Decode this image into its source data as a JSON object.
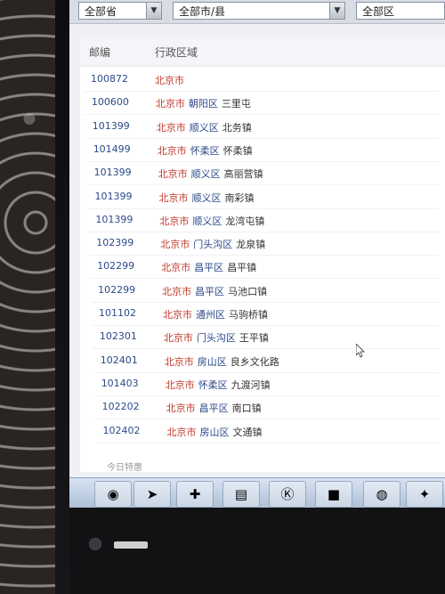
{
  "filters": {
    "province": "全部省",
    "city": "全部市/县",
    "district": "全部区"
  },
  "table": {
    "headers": {
      "postcode": "邮编",
      "region": "行政区域"
    },
    "rows": [
      {
        "postcode": "100872",
        "city": "北京市",
        "district": "",
        "town": ""
      },
      {
        "postcode": "100600",
        "city": "北京市",
        "district": "朝阳区",
        "town": "三里屯"
      },
      {
        "postcode": "101399",
        "city": "北京市",
        "district": "顺义区",
        "town": "北务镇"
      },
      {
        "postcode": "101499",
        "city": "北京市",
        "district": "怀柔区",
        "town": "怀柔镇"
      },
      {
        "postcode": "101399",
        "city": "北京市",
        "district": "顺义区",
        "town": "高丽营镇"
      },
      {
        "postcode": "101399",
        "city": "北京市",
        "district": "顺义区",
        "town": "南彩镇"
      },
      {
        "postcode": "101399",
        "city": "北京市",
        "district": "顺义区",
        "town": "龙湾屯镇"
      },
      {
        "postcode": "102399",
        "city": "北京市",
        "district": "门头沟区",
        "town": "龙泉镇"
      },
      {
        "postcode": "102299",
        "city": "北京市",
        "district": "昌平区",
        "town": "昌平镇"
      },
      {
        "postcode": "102299",
        "city": "北京市",
        "district": "昌平区",
        "town": "马池口镇"
      },
      {
        "postcode": "101102",
        "city": "北京市",
        "district": "通州区",
        "town": "马驹桥镇"
      },
      {
        "postcode": "102301",
        "city": "北京市",
        "district": "门头沟区",
        "town": "王平镇"
      },
      {
        "postcode": "102401",
        "city": "北京市",
        "district": "房山区",
        "town": "良乡文化路"
      },
      {
        "postcode": "101403",
        "city": "北京市",
        "district": "怀柔区",
        "town": "九渡河镇"
      },
      {
        "postcode": "102202",
        "city": "北京市",
        "district": "昌平区",
        "town": "南口镇"
      },
      {
        "postcode": "102402",
        "city": "北京市",
        "district": "房山区",
        "town": "文通镇"
      }
    ],
    "footer": "今日特惠"
  },
  "taskbar": {
    "icons": [
      "windows-start-icon",
      "bird-app-icon",
      "green-plus-icon",
      "folder-icon",
      "k-app-icon",
      "red-app-icon",
      "globe-icon",
      "game-icon"
    ]
  },
  "colors": {
    "city": "#c0392b",
    "district": "#2c4a8a",
    "postcode": "#2c4a8a"
  }
}
